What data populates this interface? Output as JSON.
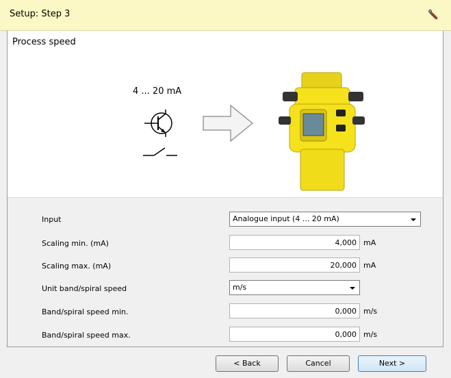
{
  "window": {
    "title": "Setup: Step 3"
  },
  "section": {
    "title": "Process speed"
  },
  "illustration": {
    "signal_label": "4 ... 20 mA"
  },
  "form": {
    "input": {
      "label": "Input",
      "value": "Analogue input (4 ... 20 mA)"
    },
    "scaling_min": {
      "label": "Scaling min. (mA)",
      "value": "4,000",
      "unit": "mA"
    },
    "scaling_max": {
      "label": "Scaling max. (mA)",
      "value": "20,000",
      "unit": "mA"
    },
    "unit_speed": {
      "label": "Unit band/spiral speed",
      "value": "m/s"
    },
    "speed_min": {
      "label": "Band/spiral speed min.",
      "value": "0,000",
      "unit": "m/s"
    },
    "speed_max": {
      "label": "Band/spiral speed max.",
      "value": "0,000",
      "unit": "m/s"
    }
  },
  "buttons": {
    "back": "< Back",
    "cancel": "Cancel",
    "next": "Next >"
  },
  "colors": {
    "titlebar": "#fcf8c6",
    "device": "#f5e21c"
  }
}
